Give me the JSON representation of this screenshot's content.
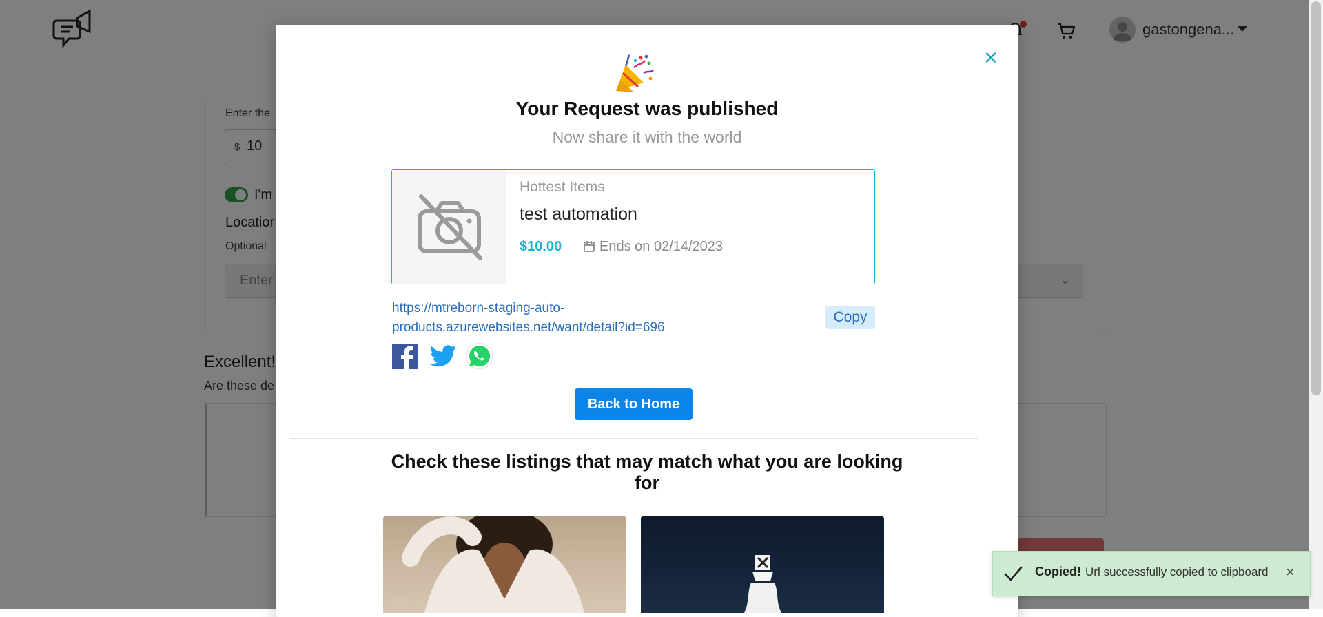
{
  "header": {
    "username": "gastongena...",
    "notification_dot_color": "#e53935",
    "icons": [
      "logo-megaphone-chat-icon",
      "bell-icon",
      "cart-icon",
      "avatar",
      "chevron-down-icon"
    ]
  },
  "background_form": {
    "price_label": "Enter the",
    "price_currency": "$",
    "price_value": "10",
    "toggle_label": "I'm",
    "location_label": "Locatior",
    "optional_label": "Optional",
    "location_placeholder": "Enter",
    "excellent_heading": "Excellent!",
    "are_these_text": "Are these de"
  },
  "modal": {
    "title": "Your Request was published",
    "subtitle": "Now share it with the world",
    "listing": {
      "category": "Hottest Items",
      "title": "test automation",
      "price": "$10.00",
      "ends_text": "Ends on 02/14/2023"
    },
    "share_url": "https://mtreborn-staging-auto-products.azurewebsites.net/want/detail?id=696",
    "copy_label": "Copy",
    "social": [
      "facebook-icon",
      "twitter-icon",
      "whatsapp-icon"
    ],
    "back_label": "Back to Home",
    "match_heading": "Check these listings that may match what you are looking for",
    "close_symbol": "×"
  },
  "toast": {
    "strong": "Copied!",
    "message": "Url successfully copied to clipboard",
    "close_symbol": "×"
  },
  "colors": {
    "accent": "#17b3d4",
    "primary_button": "#0a84e8",
    "link": "#2a6ebb",
    "toast_bg": "#cdebd0"
  }
}
